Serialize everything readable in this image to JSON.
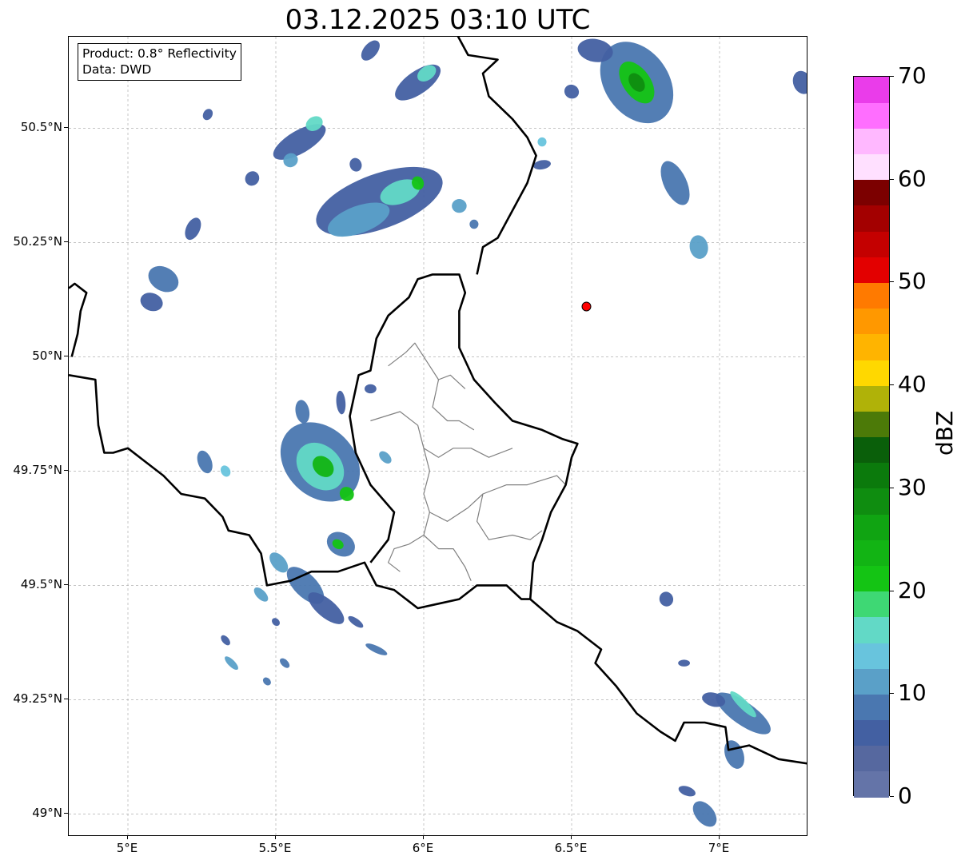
{
  "title": "03.12.2025 03:10 UTC",
  "info": {
    "product": "Product: 0.8° Reflectivity",
    "data": "Data: DWD"
  },
  "map": {
    "extent": {
      "lon_min": 4.8,
      "lon_max": 7.3,
      "lat_min": 48.95,
      "lat_max": 50.7
    },
    "lat_ticks": [
      {
        "value": 50.5,
        "label": "50.5°N"
      },
      {
        "value": 50.25,
        "label": "50.25°N"
      },
      {
        "value": 50.0,
        "label": "50°N"
      },
      {
        "value": 49.75,
        "label": "49.75°N"
      },
      {
        "value": 49.5,
        "label": "49.5°N"
      },
      {
        "value": 49.25,
        "label": "49.25°N"
      },
      {
        "value": 49.0,
        "label": "49°N"
      }
    ],
    "lon_ticks": [
      {
        "value": 5.0,
        "label": "5°E"
      },
      {
        "value": 5.5,
        "label": "5.5°E"
      },
      {
        "value": 6.0,
        "label": "6°E"
      },
      {
        "value": 6.5,
        "label": "6.5°E"
      },
      {
        "value": 7.0,
        "label": "7°E"
      }
    ],
    "gridlines": true,
    "radar_site": {
      "lon": 6.55,
      "lat": 50.11,
      "color": "#ff0000"
    },
    "national_borders": [
      [
        [
          4.8,
          49.96
        ],
        [
          4.89,
          49.95
        ],
        [
          4.9,
          49.85
        ],
        [
          4.92,
          49.79
        ],
        [
          4.95,
          49.79
        ],
        [
          5.0,
          49.8
        ],
        [
          5.06,
          49.77
        ],
        [
          5.12,
          49.74
        ],
        [
          5.18,
          49.7
        ],
        [
          5.26,
          49.69
        ],
        [
          5.32,
          49.65
        ],
        [
          5.34,
          49.62
        ],
        [
          5.41,
          49.61
        ],
        [
          5.45,
          49.57
        ],
        [
          5.47,
          49.5
        ],
        [
          5.55,
          49.51
        ],
        [
          5.62,
          49.53
        ],
        [
          5.71,
          49.53
        ],
        [
          5.8,
          49.55
        ],
        [
          5.84,
          49.5
        ],
        [
          5.9,
          49.49
        ],
        [
          5.98,
          49.45
        ],
        [
          6.05,
          49.46
        ],
        [
          6.12,
          49.47
        ],
        [
          6.18,
          49.5
        ],
        [
          6.28,
          49.5
        ],
        [
          6.33,
          49.47
        ],
        [
          6.36,
          49.47
        ],
        [
          6.45,
          49.42
        ],
        [
          6.52,
          49.4
        ],
        [
          6.6,
          49.36
        ],
        [
          6.58,
          49.33
        ],
        [
          6.65,
          49.28
        ],
        [
          6.72,
          49.22
        ],
        [
          6.8,
          49.18
        ],
        [
          6.85,
          49.16
        ],
        [
          6.88,
          49.2
        ],
        [
          6.95,
          49.2
        ],
        [
          7.02,
          49.19
        ],
        [
          7.03,
          49.14
        ],
        [
          7.1,
          49.15
        ],
        [
          7.2,
          49.12
        ],
        [
          7.3,
          49.11
        ]
      ],
      [
        [
          6.36,
          49.47
        ],
        [
          6.37,
          49.55
        ],
        [
          6.4,
          49.6
        ],
        [
          6.43,
          49.66
        ],
        [
          6.48,
          49.72
        ],
        [
          6.5,
          49.78
        ],
        [
          6.52,
          49.81
        ],
        [
          6.47,
          49.82
        ],
        [
          6.4,
          49.84
        ],
        [
          6.3,
          49.86
        ],
        [
          6.24,
          49.9
        ],
        [
          6.17,
          49.95
        ],
        [
          6.12,
          50.02
        ],
        [
          6.12,
          50.1
        ],
        [
          6.14,
          50.14
        ],
        [
          6.12,
          50.18
        ],
        [
          6.03,
          50.18
        ],
        [
          5.98,
          50.17
        ],
        [
          5.95,
          50.13
        ],
        [
          5.88,
          50.09
        ],
        [
          5.84,
          50.04
        ],
        [
          5.82,
          49.97
        ],
        [
          5.78,
          49.96
        ],
        [
          5.75,
          49.87
        ],
        [
          5.77,
          49.79
        ],
        [
          5.82,
          49.72
        ],
        [
          5.9,
          49.66
        ],
        [
          5.88,
          49.6
        ],
        [
          5.82,
          49.55
        ]
      ],
      [
        [
          6.18,
          50.18
        ],
        [
          6.2,
          50.24
        ],
        [
          6.25,
          50.26
        ],
        [
          6.3,
          50.32
        ],
        [
          6.35,
          50.38
        ],
        [
          6.38,
          50.44
        ],
        [
          6.35,
          50.48
        ],
        [
          6.3,
          50.52
        ],
        [
          6.22,
          50.57
        ],
        [
          6.2,
          50.62
        ],
        [
          6.25,
          50.65
        ],
        [
          6.15,
          50.66
        ],
        [
          6.1,
          50.72
        ]
      ],
      [
        [
          4.8,
          50.15
        ],
        [
          4.82,
          50.16
        ],
        [
          4.86,
          50.14
        ],
        [
          4.84,
          50.1
        ],
        [
          4.83,
          50.05
        ],
        [
          4.81,
          50.0
        ]
      ]
    ],
    "regional_borders": [
      [
        [
          5.88,
          49.98
        ],
        [
          5.94,
          50.01
        ],
        [
          5.97,
          50.03
        ],
        [
          6.02,
          49.98
        ],
        [
          6.05,
          49.95
        ],
        [
          6.09,
          49.96
        ],
        [
          6.14,
          49.93
        ]
      ],
      [
        [
          6.05,
          49.95
        ],
        [
          6.03,
          49.89
        ],
        [
          6.08,
          49.86
        ],
        [
          6.12,
          49.86
        ],
        [
          6.17,
          49.84
        ]
      ],
      [
        [
          5.82,
          49.86
        ],
        [
          5.92,
          49.88
        ],
        [
          5.98,
          49.85
        ],
        [
          6.0,
          49.8
        ],
        [
          6.05,
          49.78
        ],
        [
          6.1,
          49.8
        ],
        [
          6.16,
          49.8
        ],
        [
          6.22,
          49.78
        ],
        [
          6.3,
          49.8
        ]
      ],
      [
        [
          6.0,
          49.8
        ],
        [
          6.02,
          49.75
        ],
        [
          6.0,
          49.7
        ],
        [
          6.02,
          49.66
        ],
        [
          6.08,
          49.64
        ],
        [
          6.15,
          49.67
        ],
        [
          6.2,
          49.7
        ],
        [
          6.28,
          49.72
        ],
        [
          6.35,
          49.72
        ],
        [
          6.45,
          49.74
        ],
        [
          6.48,
          49.72
        ]
      ],
      [
        [
          6.02,
          49.66
        ],
        [
          6.0,
          49.61
        ],
        [
          5.95,
          49.59
        ],
        [
          5.9,
          49.58
        ],
        [
          5.88,
          49.55
        ],
        [
          5.92,
          49.53
        ]
      ],
      [
        [
          6.0,
          49.61
        ],
        [
          6.05,
          49.58
        ],
        [
          6.1,
          49.58
        ],
        [
          6.14,
          49.54
        ],
        [
          6.16,
          49.51
        ]
      ],
      [
        [
          6.2,
          49.7
        ],
        [
          6.18,
          49.64
        ],
        [
          6.22,
          49.6
        ],
        [
          6.3,
          49.61
        ],
        [
          6.36,
          49.6
        ],
        [
          6.4,
          49.62
        ]
      ]
    ],
    "reflectivity_cells": [
      {
        "lon": 5.12,
        "lat": 50.17,
        "len": 0.08,
        "wid": 0.07,
        "angle": 60,
        "dbz": 9
      },
      {
        "lon": 5.08,
        "lat": 50.12,
        "len": 0.06,
        "wid": 0.05,
        "angle": 70,
        "dbz": 7
      },
      {
        "lon": 5.22,
        "lat": 50.28,
        "len": 0.08,
        "wid": 0.03,
        "angle": 65,
        "dbz": 6
      },
      {
        "lon": 5.27,
        "lat": 50.53,
        "len": 0.04,
        "wid": 0.02,
        "angle": 60,
        "dbz": 5
      },
      {
        "lon": 5.42,
        "lat": 50.39,
        "len": 0.05,
        "wid": 0.03,
        "angle": 55,
        "dbz": 6
      },
      {
        "lon": 5.58,
        "lat": 50.47,
        "len": 0.2,
        "wid": 0.05,
        "angle": 30,
        "dbz": 7
      },
      {
        "lon": 5.63,
        "lat": 50.51,
        "len": 0.06,
        "wid": 0.03,
        "angle": 30,
        "dbz": 15
      },
      {
        "lon": 5.55,
        "lat": 50.43,
        "len": 0.05,
        "wid": 0.03,
        "angle": 30,
        "dbz": 12
      },
      {
        "lon": 5.77,
        "lat": 50.42,
        "len": 0.04,
        "wid": 0.03,
        "angle": 20,
        "dbz": 5
      },
      {
        "lon": 5.85,
        "lat": 50.34,
        "len": 0.45,
        "wid": 0.12,
        "angle": 20,
        "dbz": 7
      },
      {
        "lon": 5.78,
        "lat": 50.3,
        "len": 0.22,
        "wid": 0.06,
        "angle": 20,
        "dbz": 12
      },
      {
        "lon": 5.92,
        "lat": 50.36,
        "len": 0.14,
        "wid": 0.05,
        "angle": 20,
        "dbz": 15
      },
      {
        "lon": 5.98,
        "lat": 50.38,
        "len": 0.04,
        "wid": 0.03,
        "angle": 20,
        "dbz": 22
      },
      {
        "lon": 6.12,
        "lat": 50.33,
        "len": 0.05,
        "wid": 0.03,
        "angle": 0,
        "dbz": 12
      },
      {
        "lon": 6.17,
        "lat": 50.29,
        "len": 0.03,
        "wid": 0.02,
        "angle": 0,
        "dbz": 8
      },
      {
        "lon": 5.98,
        "lat": 50.6,
        "len": 0.18,
        "wid": 0.05,
        "angle": 35,
        "dbz": 7
      },
      {
        "lon": 6.01,
        "lat": 50.62,
        "len": 0.07,
        "wid": 0.03,
        "angle": 35,
        "dbz": 16
      },
      {
        "lon": 5.82,
        "lat": 50.67,
        "len": 0.08,
        "wid": 0.03,
        "angle": 50,
        "dbz": 6
      },
      {
        "lon": 6.72,
        "lat": 50.6,
        "len": 0.3,
        "wid": 0.14,
        "angle": -55,
        "dbz": 8
      },
      {
        "lon": 6.72,
        "lat": 50.6,
        "len": 0.16,
        "wid": 0.06,
        "angle": -55,
        "dbz": 20
      },
      {
        "lon": 6.72,
        "lat": 50.6,
        "len": 0.07,
        "wid": 0.03,
        "angle": -55,
        "dbz": 28
      },
      {
        "lon": 6.58,
        "lat": 50.67,
        "len": 0.12,
        "wid": 0.05,
        "angle": -10,
        "dbz": 7
      },
      {
        "lon": 6.85,
        "lat": 50.38,
        "len": 0.16,
        "wid": 0.05,
        "angle": -65,
        "dbz": 8
      },
      {
        "lon": 6.93,
        "lat": 50.24,
        "len": 0.08,
        "wid": 0.04,
        "angle": -80,
        "dbz": 10
      },
      {
        "lon": 6.5,
        "lat": 50.58,
        "len": 0.05,
        "wid": 0.03,
        "angle": -30,
        "dbz": 6
      },
      {
        "lon": 7.28,
        "lat": 50.6,
        "len": 0.08,
        "wid": 0.04,
        "angle": -70,
        "dbz": 7
      },
      {
        "lon": 6.4,
        "lat": 50.42,
        "len": 0.06,
        "wid": 0.02,
        "angle": 10,
        "dbz": 6
      },
      {
        "lon": 6.4,
        "lat": 50.47,
        "len": 0.03,
        "wid": 0.02,
        "angle": 0,
        "dbz": 14
      },
      {
        "lon": 5.65,
        "lat": 49.77,
        "len": 0.3,
        "wid": 0.15,
        "angle": -45,
        "dbz": 8
      },
      {
        "lon": 5.65,
        "lat": 49.76,
        "len": 0.18,
        "wid": 0.09,
        "angle": -45,
        "dbz": 16
      },
      {
        "lon": 5.66,
        "lat": 49.76,
        "len": 0.08,
        "wid": 0.04,
        "angle": -45,
        "dbz": 24
      },
      {
        "lon": 5.74,
        "lat": 49.7,
        "len": 0.05,
        "wid": 0.03,
        "angle": -45,
        "dbz": 22
      },
      {
        "lon": 5.59,
        "lat": 49.88,
        "len": 0.08,
        "wid": 0.03,
        "angle": -80,
        "dbz": 8
      },
      {
        "lon": 5.72,
        "lat": 49.9,
        "len": 0.08,
        "wid": 0.02,
        "angle": -85,
        "dbz": 7
      },
      {
        "lon": 5.82,
        "lat": 49.93,
        "len": 0.04,
        "wid": 0.02,
        "angle": 0,
        "dbz": 7
      },
      {
        "lon": 5.87,
        "lat": 49.78,
        "len": 0.05,
        "wid": 0.02,
        "angle": -45,
        "dbz": 10
      },
      {
        "lon": 5.26,
        "lat": 49.77,
        "len": 0.08,
        "wid": 0.03,
        "angle": -70,
        "dbz": 8
      },
      {
        "lon": 5.33,
        "lat": 49.75,
        "len": 0.04,
        "wid": 0.02,
        "angle": -60,
        "dbz": 14
      },
      {
        "lon": 5.72,
        "lat": 49.59,
        "len": 0.1,
        "wid": 0.05,
        "angle": -30,
        "dbz": 9
      },
      {
        "lon": 5.71,
        "lat": 49.59,
        "len": 0.04,
        "wid": 0.02,
        "angle": -30,
        "dbz": 20
      },
      {
        "lon": 5.6,
        "lat": 49.5,
        "len": 0.16,
        "wid": 0.05,
        "angle": -45,
        "dbz": 8
      },
      {
        "lon": 5.67,
        "lat": 49.45,
        "len": 0.15,
        "wid": 0.04,
        "angle": -40,
        "dbz": 7
      },
      {
        "lon": 5.51,
        "lat": 49.55,
        "len": 0.08,
        "wid": 0.03,
        "angle": -50,
        "dbz": 10
      },
      {
        "lon": 5.45,
        "lat": 49.48,
        "len": 0.06,
        "wid": 0.02,
        "angle": -45,
        "dbz": 12
      },
      {
        "lon": 5.84,
        "lat": 49.36,
        "len": 0.08,
        "wid": 0.015,
        "angle": -25,
        "dbz": 8
      },
      {
        "lon": 5.77,
        "lat": 49.42,
        "len": 0.06,
        "wid": 0.015,
        "angle": -35,
        "dbz": 7
      },
      {
        "lon": 5.35,
        "lat": 49.33,
        "len": 0.06,
        "wid": 0.015,
        "angle": -45,
        "dbz": 12
      },
      {
        "lon": 5.33,
        "lat": 49.38,
        "len": 0.04,
        "wid": 0.015,
        "angle": -50,
        "dbz": 7
      },
      {
        "lon": 5.47,
        "lat": 49.29,
        "len": 0.03,
        "wid": 0.015,
        "angle": -45,
        "dbz": 8
      },
      {
        "lon": 5.53,
        "lat": 49.33,
        "len": 0.04,
        "wid": 0.015,
        "angle": -45,
        "dbz": 8
      },
      {
        "lon": 5.5,
        "lat": 49.42,
        "len": 0.03,
        "wid": 0.015,
        "angle": -45,
        "dbz": 7
      },
      {
        "lon": 6.82,
        "lat": 49.47,
        "len": 0.05,
        "wid": 0.03,
        "angle": -70,
        "dbz": 7
      },
      {
        "lon": 7.08,
        "lat": 49.22,
        "len": 0.22,
        "wid": 0.05,
        "angle": -35,
        "dbz": 8
      },
      {
        "lon": 7.08,
        "lat": 49.24,
        "len": 0.12,
        "wid": 0.02,
        "angle": -45,
        "dbz": 16
      },
      {
        "lon": 6.98,
        "lat": 49.25,
        "len": 0.08,
        "wid": 0.03,
        "angle": -15,
        "dbz": 7
      },
      {
        "lon": 7.05,
        "lat": 49.13,
        "len": 0.1,
        "wid": 0.04,
        "angle": -70,
        "dbz": 8
      },
      {
        "lon": 6.95,
        "lat": 49.0,
        "len": 0.1,
        "wid": 0.04,
        "angle": -50,
        "dbz": 8
      },
      {
        "lon": 6.89,
        "lat": 49.05,
        "len": 0.06,
        "wid": 0.02,
        "angle": -20,
        "dbz": 7
      },
      {
        "lon": 6.88,
        "lat": 49.33,
        "len": 0.04,
        "wid": 0.015,
        "angle": 0,
        "dbz": 7
      }
    ]
  },
  "colorbar": {
    "label": "dBZ",
    "min": 0,
    "max": 70,
    "step": 2.5,
    "ticks": [
      {
        "value": 0,
        "label": "0"
      },
      {
        "value": 10,
        "label": "10"
      },
      {
        "value": 20,
        "label": "20"
      },
      {
        "value": 30,
        "label": "30"
      },
      {
        "value": 40,
        "label": "40"
      },
      {
        "value": 50,
        "label": "50"
      },
      {
        "value": 60,
        "label": "60"
      },
      {
        "value": 70,
        "label": "70"
      }
    ],
    "colors": [
      "#6474a8",
      "#56689f",
      "#4360a2",
      "#4a77b0",
      "#5aa0c8",
      "#68c4dd",
      "#62d9c6",
      "#3ed874",
      "#14c414",
      "#12b414",
      "#10a412",
      "#0f8d10",
      "#0b7a0c",
      "#0a5f0a",
      "#4c7a08",
      "#b0b208",
      "#ffd800",
      "#ffb400",
      "#ff9800",
      "#ff7a00",
      "#e30000",
      "#c40000",
      "#a30000",
      "#7c0000",
      "#ffe0ff",
      "#ffb8ff",
      "#ff6eff",
      "#ea3cea"
    ]
  }
}
